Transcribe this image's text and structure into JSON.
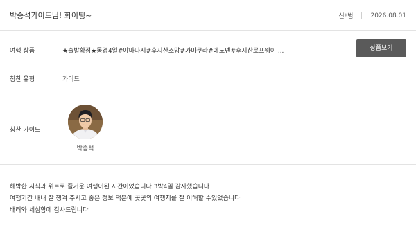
{
  "header": {
    "title": "박종석가이드님! 화이팅~",
    "author": "신*범",
    "date": "2026.08.01"
  },
  "product": {
    "label": "여행 상품",
    "value": "★출발확정★동경4일#야마나시#후지산조망#가마쿠라#에노덴#후지산로프웨이 ...",
    "button_label": "상품보기"
  },
  "praise_type": {
    "label": "칭찬 유형",
    "value": "가이드"
  },
  "praise_guide": {
    "label": "칭찬 가이드",
    "name": "박종석"
  },
  "comment": {
    "lines": [
      "해박한 지식과 위트로 즐거운 여행이된 시간이었습니다 3박4일 감사했습니다",
      "여행기간 내내 잘 챙겨 주시고 좋은 정보 덕분에 곳곳의 여행지를 잘 이해할 수있었습니다",
      "배려와 세심함에 감사드립니다"
    ]
  }
}
